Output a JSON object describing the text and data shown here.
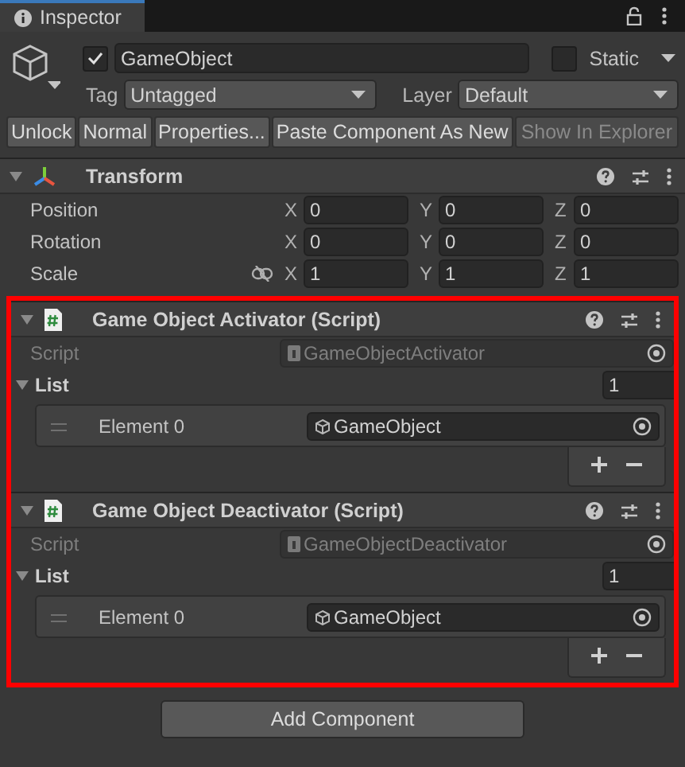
{
  "tab": {
    "title": "Inspector"
  },
  "game_object": {
    "active": true,
    "name": "GameObject",
    "static_label": "Static",
    "static": false,
    "tag_label": "Tag",
    "tag": "Untagged",
    "layer_label": "Layer",
    "layer": "Default"
  },
  "toolbar_buttons": [
    {
      "label": "Unlock",
      "disabled": false
    },
    {
      "label": "Normal",
      "disabled": false
    },
    {
      "label": "Properties...",
      "disabled": false
    },
    {
      "label": "Paste Component As New",
      "disabled": false
    },
    {
      "label": "Show In Explorer",
      "disabled": true
    }
  ],
  "transform": {
    "title": "Transform",
    "expanded": true,
    "rows": [
      {
        "label": "Position",
        "link_toggle": false,
        "values": [
          {
            "axis": "X",
            "value": "0"
          },
          {
            "axis": "Y",
            "value": "0"
          },
          {
            "axis": "Z",
            "value": "0"
          }
        ]
      },
      {
        "label": "Rotation",
        "link_toggle": false,
        "values": [
          {
            "axis": "X",
            "value": "0"
          },
          {
            "axis": "Y",
            "value": "0"
          },
          {
            "axis": "Z",
            "value": "0"
          }
        ]
      },
      {
        "label": "Scale",
        "link_toggle": true,
        "values": [
          {
            "axis": "X",
            "value": "1"
          },
          {
            "axis": "Y",
            "value": "1"
          },
          {
            "axis": "Z",
            "value": "1"
          }
        ]
      }
    ]
  },
  "scripts_highlighted": true,
  "components": [
    {
      "title": "Game Object Activator (Script)",
      "expanded": true,
      "script_label": "Script",
      "script": "GameObjectActivator",
      "list": {
        "label": "List",
        "expanded": true,
        "size": "1",
        "elements": [
          {
            "label": "Element 0",
            "value": "GameObject"
          }
        ]
      }
    },
    {
      "title": "Game Object Deactivator (Script)",
      "expanded": true,
      "script_label": "Script",
      "script": "GameObjectDeactivator",
      "list": {
        "label": "List",
        "expanded": true,
        "size": "1",
        "elements": [
          {
            "label": "Element 0",
            "value": "GameObject"
          }
        ]
      }
    }
  ],
  "add_button": {
    "label": "Add Component"
  }
}
